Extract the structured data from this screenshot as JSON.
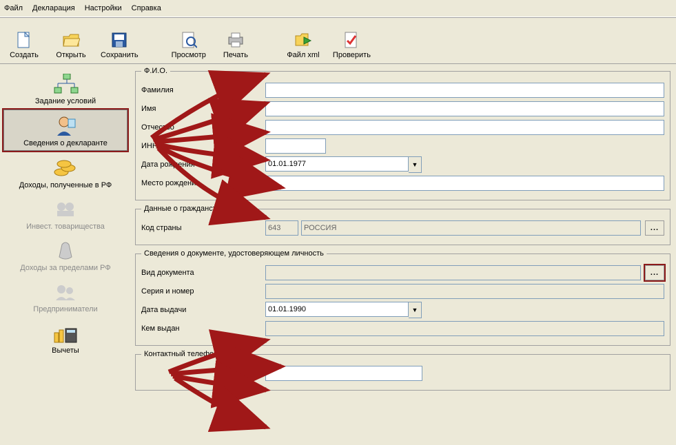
{
  "menu": {
    "file": "Файл",
    "decl": "Декларация",
    "settings": "Настройки",
    "help": "Справка"
  },
  "toolbar": {
    "create": "Создать",
    "open": "Открыть",
    "save": "Сохранить",
    "preview": "Просмотр",
    "print": "Печать",
    "filexml": "Файл xml",
    "check": "Проверить"
  },
  "side": {
    "cond": "Задание условий",
    "declarant": "Сведения о декларанте",
    "income_rf": "Доходы, полученные в РФ",
    "invest": "Инвест. товарищества",
    "income_abroad": "Доходы за пределами РФ",
    "entrepr": "Предприниматели",
    "deduct": "Вычеты"
  },
  "fio": {
    "legend": "Ф.И.О.",
    "surname_l": "Фамилия",
    "surname_v": "",
    "name_l": "Имя",
    "name_v": "",
    "patr_l": "Отчество",
    "patr_v": "",
    "inn_l": "ИНН",
    "inn_v": "",
    "dob_l": "Дата рождения",
    "dob_v": "01.01.1977",
    "pob_l": "Место рождения",
    "pob_v": ""
  },
  "cit": {
    "legend": "Данные о гражданстве",
    "code_l": "Код страны",
    "code_v": "643",
    "country_v": "РОССИЯ"
  },
  "doc": {
    "legend": "Сведения о документе, удостоверяющем личность",
    "type_l": "Вид документа",
    "type_v": "",
    "serial_l": "Серия и номер",
    "serial_v": "",
    "date_l": "Дата выдачи",
    "date_v": "01.01.1990",
    "issuer_l": "Кем выдан",
    "issuer_v": ""
  },
  "phone": {
    "legend": "Контактный телефон",
    "v": ""
  },
  "glyph": {
    "dots": "...",
    "tri": "▼"
  }
}
